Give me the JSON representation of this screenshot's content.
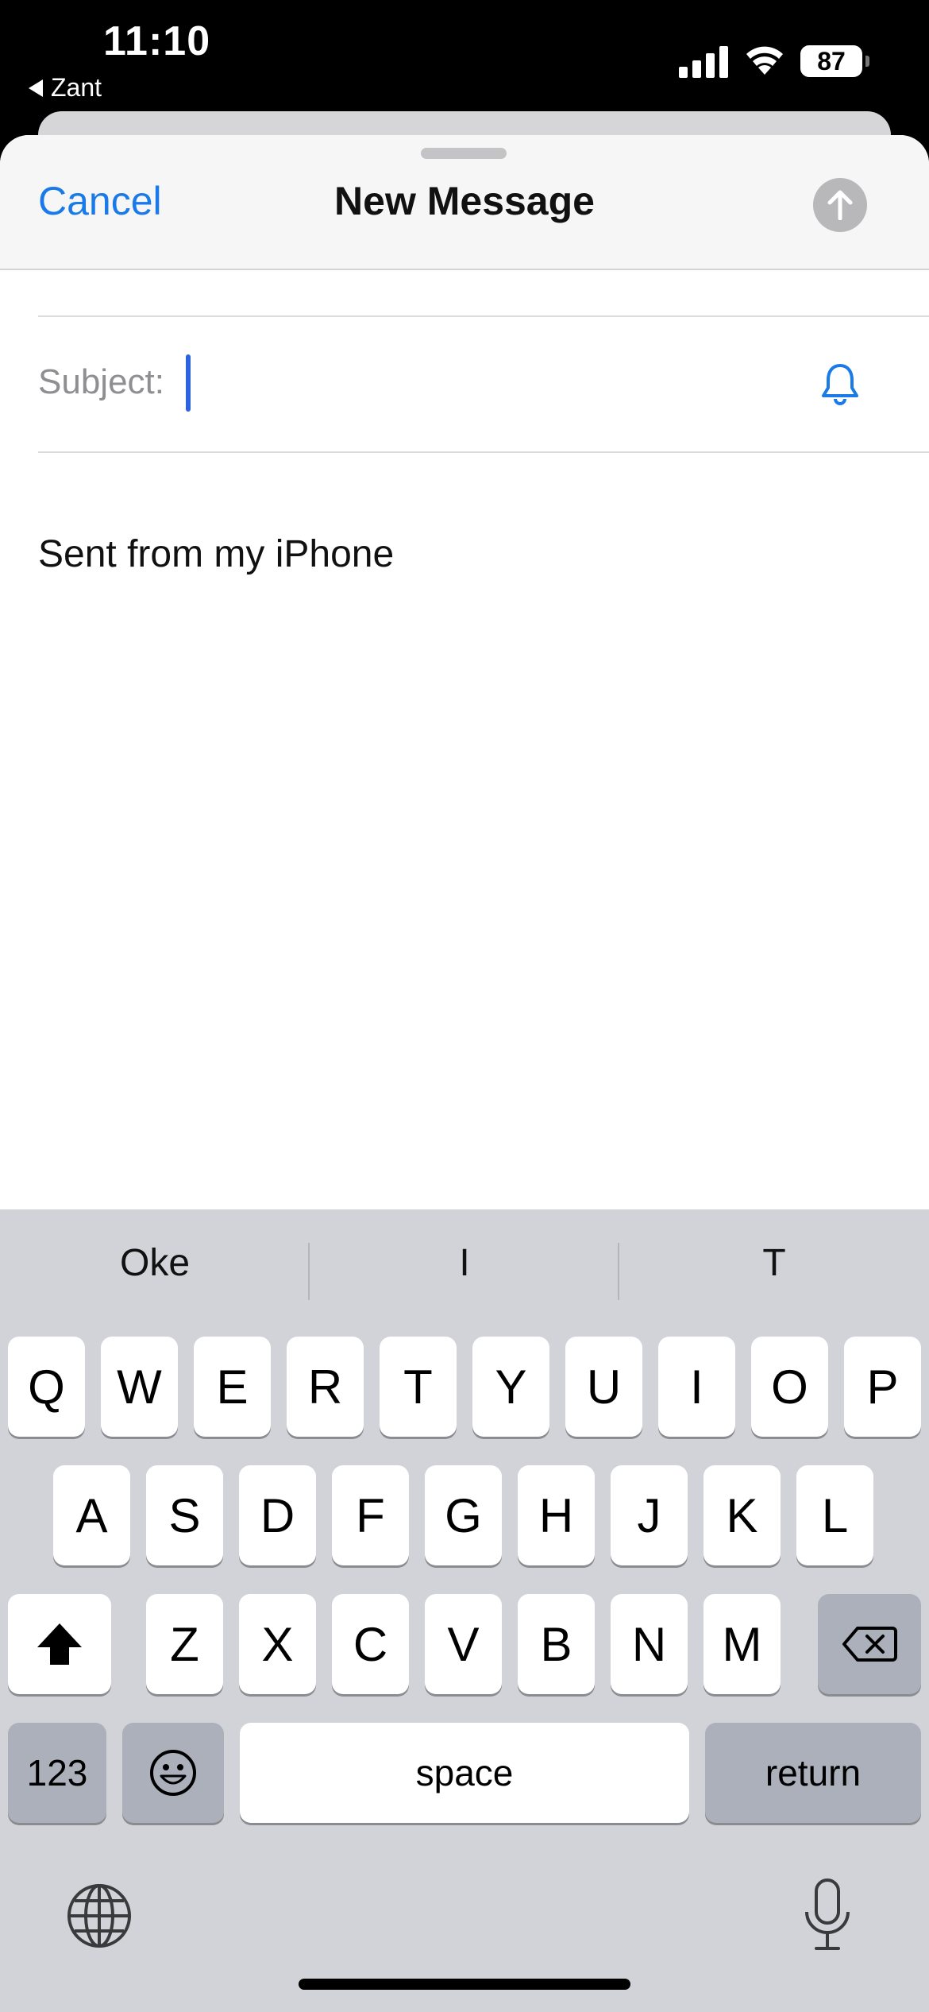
{
  "status_bar": {
    "time": "11:10",
    "back_app": "Zant",
    "battery": "87"
  },
  "sheet": {
    "cancel_label": "Cancel",
    "title": "New Message",
    "subject_label": "Subject:",
    "subject_value": "",
    "body_text": "Sent from my iPhone"
  },
  "colors": {
    "accent": "#1a7ae8",
    "cursor": "#2c64e0",
    "keyboard_bg": "#d1d3d9"
  },
  "keyboard": {
    "suggestions": [
      "Oke",
      "I",
      "T"
    ],
    "row1": [
      "Q",
      "W",
      "E",
      "R",
      "T",
      "Y",
      "U",
      "I",
      "O",
      "P"
    ],
    "row2": [
      "A",
      "S",
      "D",
      "F",
      "G",
      "H",
      "J",
      "K",
      "L"
    ],
    "row3": [
      "Z",
      "X",
      "C",
      "V",
      "B",
      "N",
      "M"
    ],
    "numbers_label": "123",
    "space_label": "space",
    "return_label": "return",
    "icons": [
      "shift-icon",
      "backspace-icon",
      "emoji-icon",
      "globe-icon",
      "microphone-icon"
    ]
  }
}
